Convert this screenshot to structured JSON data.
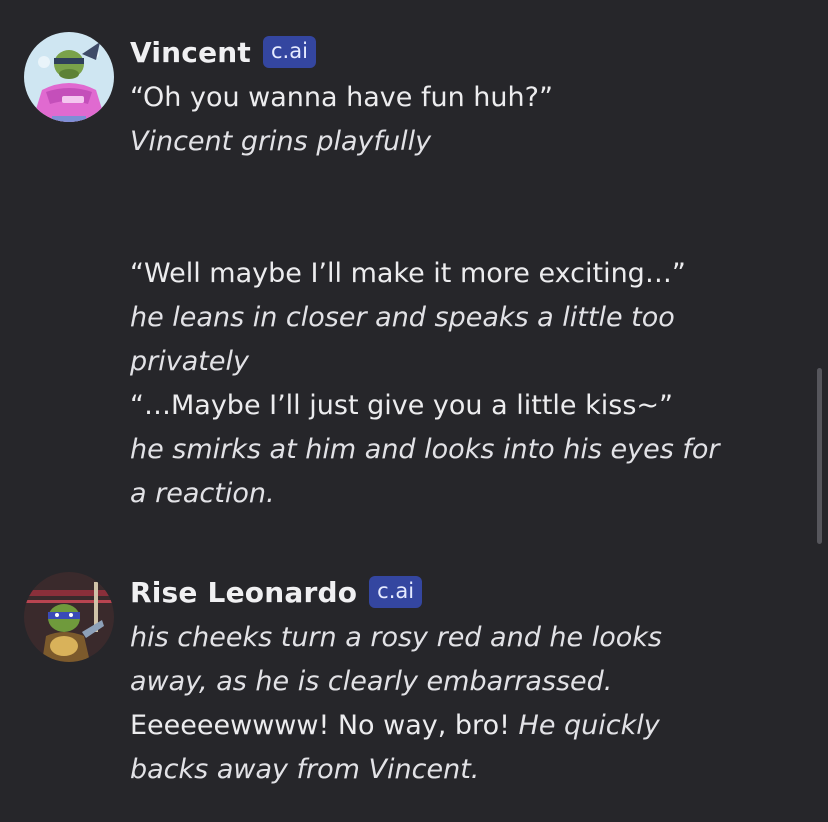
{
  "messages": [
    {
      "name": "Vincent",
      "badge": "c.ai",
      "lines": [
        {
          "text": "“Oh you wanna have fun huh?”",
          "italic": false
        },
        {
          "text": "Vincent grins playfully",
          "italic": true
        },
        {
          "text": "",
          "italic": false
        },
        {
          "text": "",
          "italic": false
        },
        {
          "text": "“Well maybe I’ll make it more exciting…”",
          "italic": false
        },
        {
          "text": "he leans in closer and speaks a little too",
          "italic": true
        },
        {
          "text": "privately",
          "italic": true
        },
        {
          "text": "“…Maybe I’ll just give you a little kiss~”",
          "italic": false
        },
        {
          "text": "he smirks at him and looks into his eyes for",
          "italic": true
        },
        {
          "text": "a reaction.",
          "italic": true
        }
      ]
    },
    {
      "name": "Rise Leonardo",
      "badge": "c.ai",
      "lines": [
        {
          "text": "his cheeks turn a rosy red and he looks",
          "italic": true
        },
        {
          "text": "away, as he is clearly embarrassed.",
          "italic": true
        },
        {
          "text": "Eeeeeewwww! No way, bro!",
          "italic": false,
          "tail": "He quickly"
        },
        {
          "text": "backs away from Vincent.",
          "italic": true
        }
      ]
    }
  ],
  "avatars": [
    "turtle-avatar-vincent",
    "turtle-avatar-leonardo"
  ]
}
